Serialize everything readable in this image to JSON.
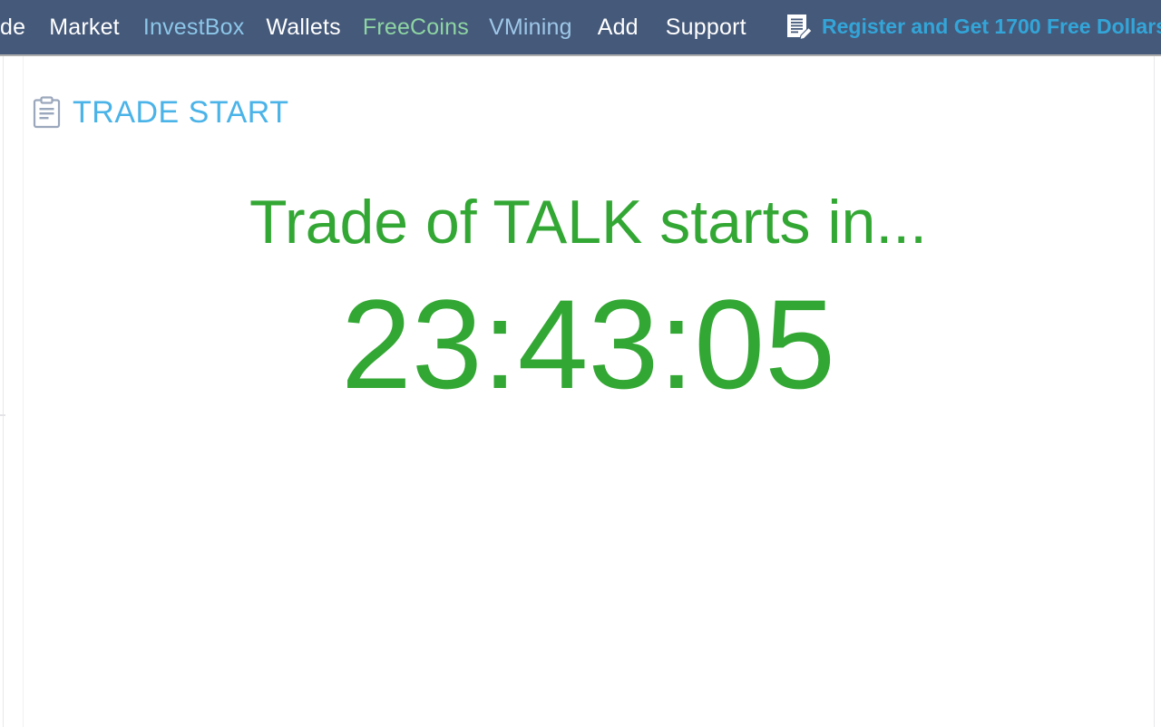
{
  "navbar": {
    "background_color": "#45597a",
    "items": [
      {
        "label": "de",
        "name": "trade",
        "color": "#ffffff"
      },
      {
        "label": "Market",
        "name": "market",
        "color": "#ffffff"
      },
      {
        "label": "InvestBox",
        "name": "investbox",
        "color": "#8cc6e8"
      },
      {
        "label": "Wallets",
        "name": "wallets",
        "color": "#ffffff"
      },
      {
        "label": "FreeCoins",
        "name": "freecoins",
        "color": "#8ed5a3"
      },
      {
        "label": "VMining",
        "name": "vmining",
        "color": "#9ec7e8"
      },
      {
        "label": "Add",
        "name": "add",
        "color": "#ffffff"
      },
      {
        "label": "Support",
        "name": "support",
        "color": "#ffffff"
      }
    ],
    "register_promo": {
      "label": "Register and Get 1700 Free Dollars!",
      "icon": "form-pencil-icon",
      "color": "#33a5d8"
    }
  },
  "page": {
    "section_heading": {
      "title": "TRADE START",
      "icon": "clipboard-icon",
      "color": "#4ab3e8"
    },
    "countdown": {
      "message": "Trade of TALK starts in...",
      "timer": "23:43:05",
      "color": "#33a734",
      "hours": "23",
      "minutes": "43",
      "seconds": "05",
      "ticker": "TALK"
    }
  }
}
